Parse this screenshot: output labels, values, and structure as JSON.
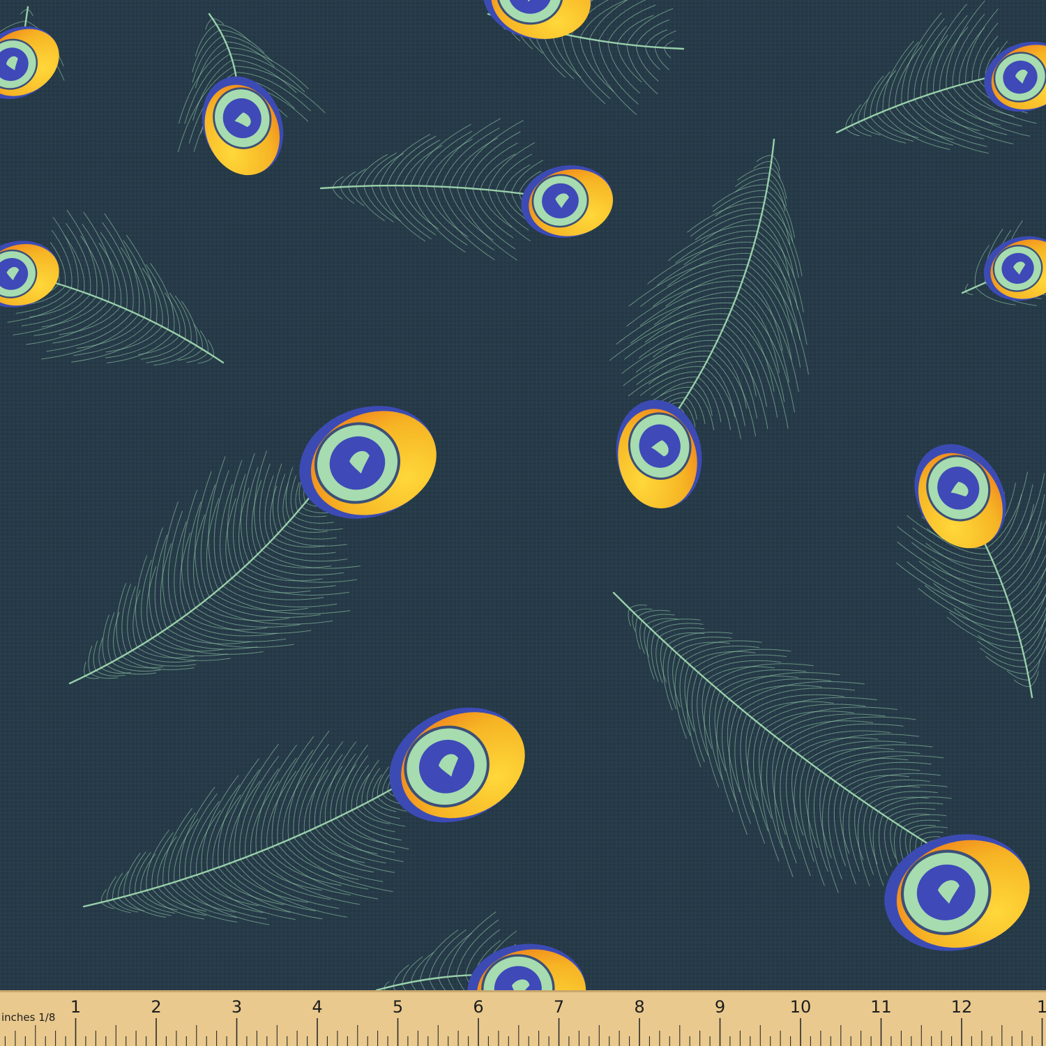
{
  "image": {
    "kind": "fabric swatch with ruler",
    "colors": {
      "background": "#263a48",
      "feather_fiber": "#9fd8b0",
      "eye_outer_blue": "#3c4bb4",
      "eye_orange": "#f08a1e",
      "eye_yellow": "#f7c52a",
      "eye_ring": "#a6dcb0",
      "eye_center": "#3f49b8",
      "ruler_wood": "#e9c98e"
    }
  },
  "ruler": {
    "unit_label": "inches 1/8",
    "numbers": [
      "1",
      "2",
      "3",
      "4",
      "5",
      "6",
      "7",
      "8",
      "9",
      "10",
      "11",
      "12",
      "1"
    ]
  }
}
